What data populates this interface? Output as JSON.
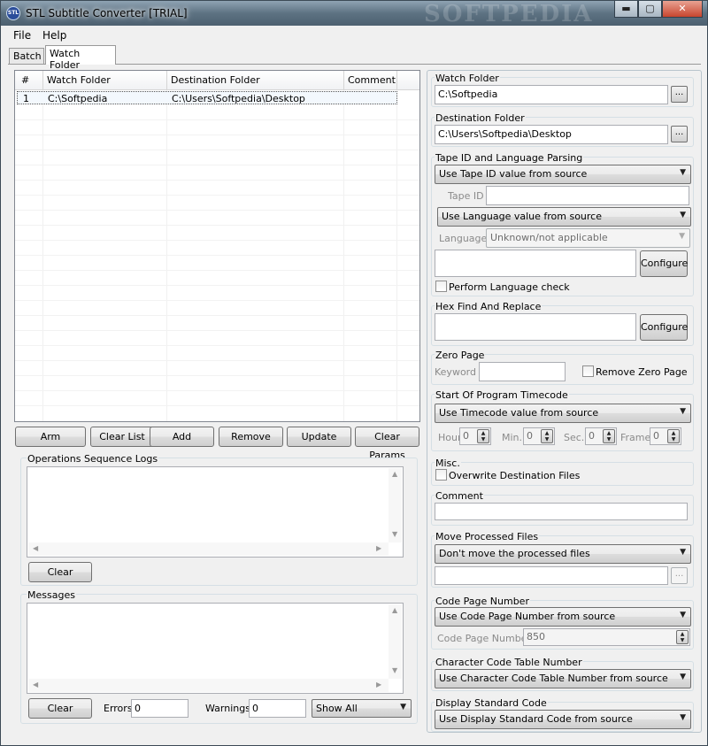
{
  "window": {
    "title": "STL Subtitle Converter [TRIAL]",
    "logo_text": "STL",
    "watermark": "SOFTPEDIA",
    "minimize_glyph": "▬",
    "maximize_glyph": "▢",
    "close_glyph": "✕"
  },
  "menu": {
    "file": "File",
    "help": "Help"
  },
  "tabs": {
    "batch": "Batch",
    "watch_folder": "Watch Folder"
  },
  "grid": {
    "columns": [
      "#",
      "Watch Folder",
      "Destination Folder",
      "Comment"
    ],
    "rows": [
      {
        "num": "1",
        "watch_folder": "C:\\Softpedia",
        "destination_folder": "C:\\Users\\Softpedia\\Desktop",
        "comment": ""
      }
    ]
  },
  "actions": {
    "arm": "Arm",
    "clear_list": "Clear List",
    "add": "Add",
    "remove": "Remove",
    "update": "Update",
    "clear_params": "Clear Params"
  },
  "logs": {
    "title": "Operations Sequence Logs",
    "clear": "Clear"
  },
  "messages": {
    "title": "Messages",
    "clear": "Clear",
    "errors_label": "Errors",
    "errors_value": "0",
    "warnings_label": "Warnings",
    "warnings_value": "0",
    "filter": "Show All"
  },
  "settings": {
    "watch_folder": {
      "label": "Watch Folder",
      "value": "C:\\Softpedia",
      "browse": "..."
    },
    "destination_folder": {
      "label": "Destination Folder",
      "value": "C:\\Users\\Softpedia\\Desktop",
      "browse": "..."
    },
    "tape_lang": {
      "label": "Tape ID and Language Parsing",
      "tape_mode": "Use Tape ID value from source",
      "tape_id_label": "Tape ID",
      "tape_id_value": "",
      "lang_mode": "Use Language value from source",
      "language_label": "Language",
      "language_value": "Unknown/not applicable",
      "configure": "Configure",
      "perform_check": "Perform Language check"
    },
    "hex": {
      "label": "Hex Find And Replace",
      "configure": "Configure"
    },
    "zero_page": {
      "label": "Zero Page",
      "keyword_label": "Keyword",
      "keyword_value": "",
      "remove": "Remove Zero Page"
    },
    "timecode": {
      "label": "Start Of Program Timecode",
      "mode": "Use Timecode value from source",
      "hour_label": "Hour",
      "hour": "0",
      "min_label": "Min.",
      "min": "0",
      "sec_label": "Sec.",
      "sec": "0",
      "frame_label": "Frame",
      "frame": "0"
    },
    "misc": {
      "label": "Misc.",
      "overwrite": "Overwrite Destination Files"
    },
    "comment": {
      "label": "Comment",
      "value": ""
    },
    "move": {
      "label": "Move Processed Files",
      "mode": "Don't move the processed files",
      "path": "",
      "browse": "..."
    },
    "code_page": {
      "label": "Code Page Number",
      "mode": "Use Code Page Number from source",
      "number_label": "Code Page Number",
      "number": "850"
    },
    "char_table": {
      "label": "Character Code Table Number",
      "mode": "Use Character Code Table Number from source"
    },
    "display_std": {
      "label": "Display Standard Code",
      "mode": "Use Display Standard Code from source"
    }
  }
}
